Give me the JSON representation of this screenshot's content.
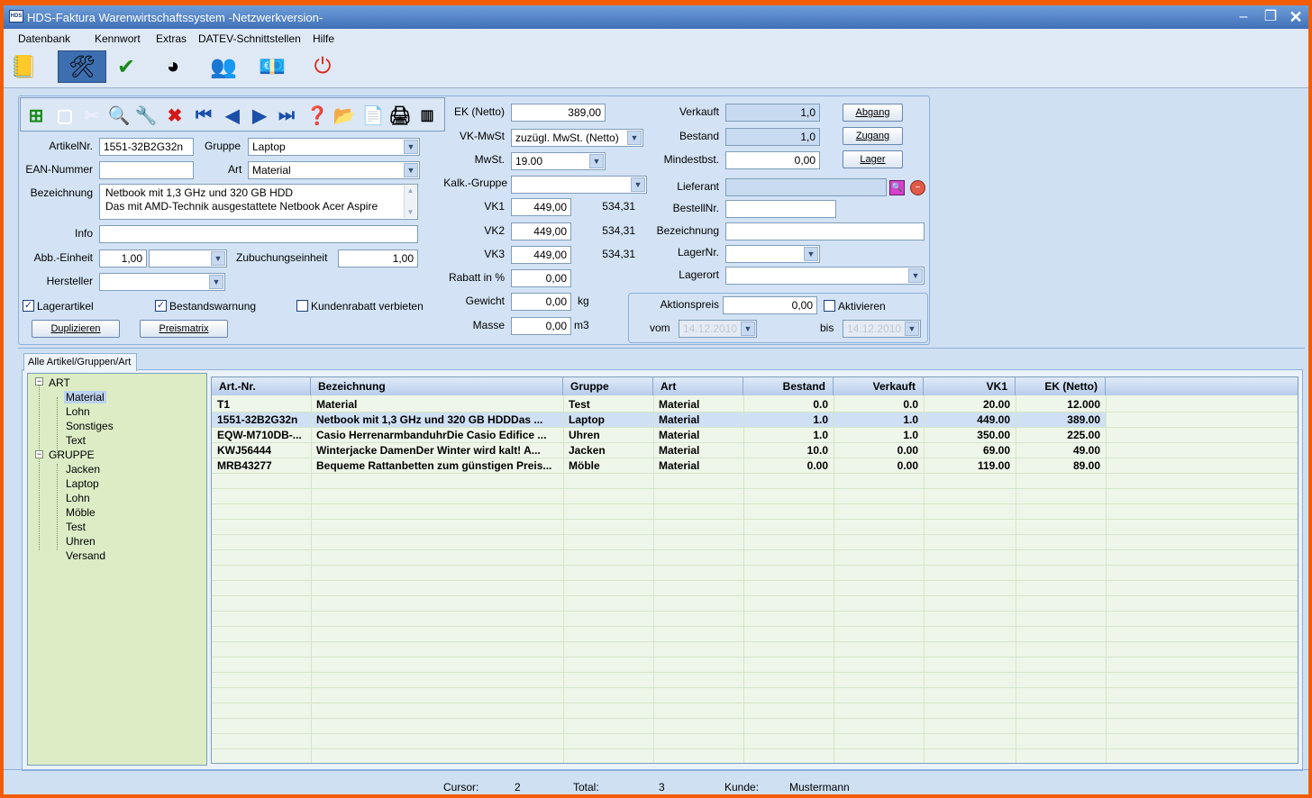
{
  "window": {
    "title": "HDS-Faktura Warenwirtschaftssystem -Netzwerkversion-",
    "app_icon": "HDS"
  },
  "menu": [
    "Datenbank",
    "Kennwort",
    "Extras",
    "DATEV-Schnittstellen",
    "Hilfe"
  ],
  "form": {
    "artikelnr_label": "ArtikelNr.",
    "artikelnr": "1551-32B2G32n",
    "gruppe_label": "Gruppe",
    "gruppe": "Laptop",
    "ean_label": "EAN-Nummer",
    "ean": "",
    "art_label": "Art",
    "art": "Material",
    "bezeichnung_label": "Bezeichnung",
    "bezeichnung_line1": "Netbook mit 1,3 GHz und 320 GB HDD",
    "bezeichnung_line2": "Das mit AMD-Technik ausgestattete Netbook Acer Aspire",
    "info_label": "Info",
    "info": "",
    "abb_label": "Abb.-Einheit",
    "abb": "1,00",
    "abb_unit": "",
    "zubuchung_label": "Zubuchungseinheit",
    "zubuchung": "1,00",
    "hersteller_label": "Hersteller",
    "hersteller": "",
    "lagerartikel": "Lagerartikel",
    "bestandswarnung": "Bestandswarnung",
    "kundenrabatt": "Kundenrabatt verbieten",
    "duplizieren": "Duplizieren",
    "preismatrix": "Preismatrix",
    "ek_label": "EK (Netto)",
    "ek": "389,00",
    "vkmwst_label": "VK-MwSt",
    "vkmwst": "zuzügl. MwSt. (Netto)",
    "mwst_label": "MwSt.",
    "mwst": "19.00",
    "kalk_label": "Kalk.-Gruppe",
    "kalk": "",
    "vk1_label": "VK1",
    "vk1": "449,00",
    "vk1_brutto": "534,31",
    "vk2_label": "VK2",
    "vk2": "449,00",
    "vk2_brutto": "534,31",
    "vk3_label": "VK3",
    "vk3": "449,00",
    "vk3_brutto": "534,31",
    "rabatt_label": "Rabatt in %",
    "rabatt": "0,00",
    "gewicht_label": "Gewicht",
    "gewicht": "0,00",
    "gewicht_unit": "kg",
    "masse_label": "Masse",
    "masse": "0,00",
    "masse_unit": "m3",
    "verkauft_label": "Verkauft",
    "verkauft": "1,0",
    "bestand_label": "Bestand",
    "bestand": "1,0",
    "mindest_label": "Mindestbst.",
    "mindest": "0,00",
    "abgang": "Abgang",
    "zugang": "Zugang",
    "lager": "Lager",
    "lieferant_label": "Lieferant",
    "lieferant": "",
    "bestellnr_label": "BestellNr.",
    "bestellnr": "",
    "bez2_label": "Bezeichnung",
    "bez2": "",
    "lagernr_label": "LagerNr.",
    "lagernr": "",
    "lagerort_label": "Lagerort",
    "lagerort": "",
    "aktionspreis_label": "Aktionspreis",
    "aktionspreis": "0,00",
    "aktivieren": "Aktivieren",
    "vom_label": "vom",
    "vom": "14.12.2010",
    "bis_label": "bis",
    "bis": "14.12.2010"
  },
  "tab": "Alle Artikel/Gruppen/Art",
  "tree": {
    "art": "ART",
    "art_items": [
      "Material",
      "Lohn",
      "Sonstiges",
      "Text"
    ],
    "gruppe": "GRUPPE",
    "gruppe_items": [
      "Jacken",
      "Laptop",
      "Lohn",
      "Möble",
      "Test",
      "Uhren",
      "Versand"
    ]
  },
  "grid": {
    "headers": [
      "Art.-Nr.",
      "Bezeichnung",
      "Gruppe",
      "Art",
      "Bestand",
      "Verkauft",
      "VK1",
      "EK (Netto)"
    ],
    "rows": [
      [
        "T1",
        "Material",
        "Test",
        "Material",
        "0.0",
        "0.0",
        "20.00",
        "12.000"
      ],
      [
        "1551-32B2G32n",
        "Netbook mit 1,3 GHz und 320 GB HDDDas ...",
        "Laptop",
        "Material",
        "1.0",
        "1.0",
        "449.00",
        "389.00"
      ],
      [
        "EQW-M710DB-...",
        "Casio HerrenarmbanduhrDie Casio Edifice ...",
        "Uhren",
        "Material",
        "1.0",
        "1.0",
        "350.00",
        "225.00"
      ],
      [
        "KWJ56444",
        "Winterjacke DamenDer Winter wird kalt! A...",
        "Jacken",
        "Material",
        "10.0",
        "0.00",
        "69.00",
        "49.00"
      ],
      [
        "MRB43277",
        "Bequeme Rattanbetten zum günstigen Preis...",
        "Möble",
        "Material",
        "0.00",
        "0.00",
        "119.00",
        "89.00"
      ]
    ]
  },
  "status": {
    "cursor_label": "Cursor:",
    "cursor": "2",
    "total_label": "Total:",
    "total": "3",
    "kunde_label": "Kunde:",
    "kunde": "Mustermann"
  },
  "colors": {
    "accent": "#3d6fb0",
    "tree_bg": "#dcedc6",
    "grid_bg": "#eef6e9",
    "frame": "#f25c05"
  }
}
